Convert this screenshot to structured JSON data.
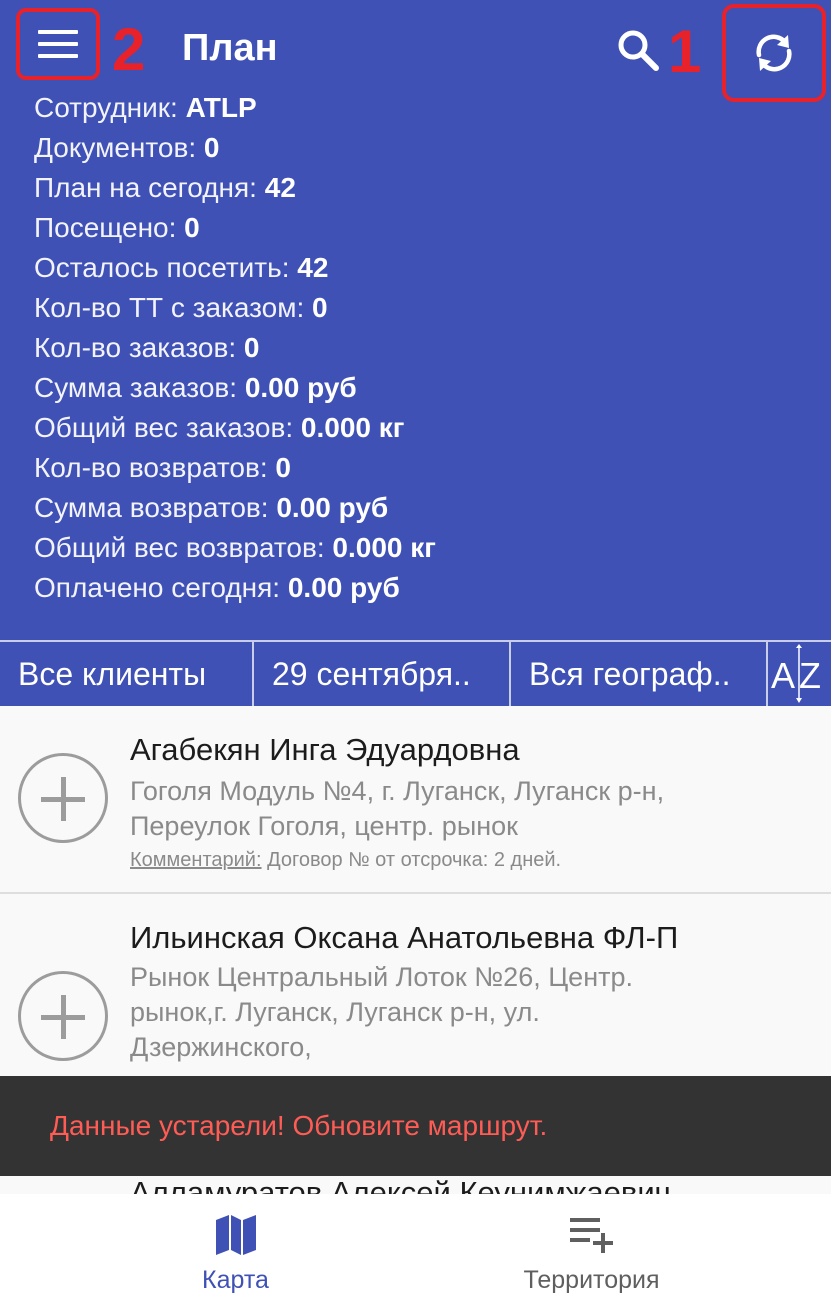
{
  "appbar": {
    "title": "План",
    "annotation_menu": "2",
    "annotation_sync": "1",
    "icons": {
      "menu": "menu-icon",
      "search": "search-icon",
      "sync": "sync-icon"
    },
    "accent_color": "#3f51b5",
    "highlight_color": "#e8222a"
  },
  "stats": [
    {
      "label": "Сотрудник: ",
      "value": "ATLP"
    },
    {
      "label": "Документов: ",
      "value": "0"
    },
    {
      "label": "План на сегодня: ",
      "value": "42"
    },
    {
      "label": "Посещено: ",
      "value": "0"
    },
    {
      "label": "Осталось посетить: ",
      "value": "42"
    },
    {
      "label": "Кол-во ТТ с заказом: ",
      "value": "0"
    },
    {
      "label": "Кол-во заказов: ",
      "value": "0"
    },
    {
      "label": "Сумма заказов: ",
      "value": "0.00 руб"
    },
    {
      "label": "Общий вес заказов: ",
      "value": "0.000 кг"
    },
    {
      "label": "Кол-во возвратов: ",
      "value": "0"
    },
    {
      "label": "Сумма возвратов: ",
      "value": "0.00 руб"
    },
    {
      "label": "Общий вес возвратов: ",
      "value": "0.000 кг"
    },
    {
      "label": "Оплачено сегодня: ",
      "value": "0.00 руб"
    }
  ],
  "filters": {
    "clients": "Все клиенты",
    "date": "29 сентября..",
    "geography": "Вся географ..",
    "sort_icon": "sort-az-icon"
  },
  "clients": [
    {
      "name": "Агабекян Инга Эдуардовна",
      "address_line1": "Гоголя Модуль №4, г. Луганск, Луганск р-н,",
      "address_line2": "Переулок Гоголя, центр. рынок",
      "comment_label": "Комментарий:",
      "comment": " Договор № от отсрочка: 2 дней."
    },
    {
      "name": "Ильинская Оксана Анатольевна ФЛ-П",
      "address_line1": "Рынок Центральный Лоток №26, Центр.",
      "address_line2": "рынок,г. Луганск, Луганск р-н, ул.",
      "address_line3": "Дзержинского,"
    },
    {
      "name": "Алламуратов Алексей Кеунимжаевич"
    }
  ],
  "snackbar": {
    "text": "Данные устарели! Обновите маршрут."
  },
  "bottom_nav": [
    {
      "label": "Карта",
      "icon": "map-icon",
      "active": true,
      "color": "#3f51b5"
    },
    {
      "label": "Территория",
      "icon": "playlist-add-icon",
      "active": false,
      "color": "#5f5f5f"
    }
  ]
}
